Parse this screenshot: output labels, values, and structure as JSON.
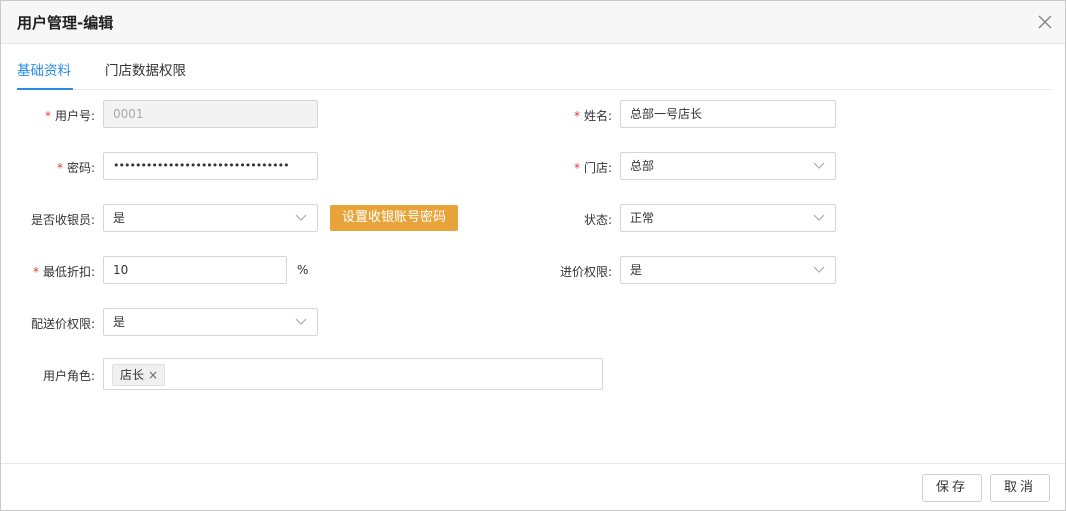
{
  "dialog": {
    "title": "用户管理-编辑"
  },
  "tabs": [
    {
      "label": "基础资料",
      "active": true
    },
    {
      "label": "门店数据权限",
      "active": false
    }
  ],
  "form": {
    "user_no": {
      "label": "用户号:",
      "value": "0001",
      "required": true
    },
    "name": {
      "label": "姓名:",
      "value": "总部一号店长",
      "required": true
    },
    "password": {
      "label": "密码:",
      "value": "••••••••••••••••••••••••••••••••",
      "required": true
    },
    "store": {
      "label": "门店:",
      "value": "总部",
      "required": true
    },
    "is_cashier": {
      "label": "是否收银员:",
      "value": "是"
    },
    "set_cashier_pwd_button": "设置收银账号密码",
    "status": {
      "label": "状态:",
      "value": "正常"
    },
    "min_discount": {
      "label": "最低折扣:",
      "value": "10",
      "unit": "%",
      "required": true
    },
    "purchase_price_perm": {
      "label": "进价权限:",
      "value": "是"
    },
    "delivery_price_perm": {
      "label": "配送价权限:",
      "value": "是"
    },
    "user_role": {
      "label": "用户角色:",
      "tags": [
        "店长"
      ],
      "tag_remove": "×"
    }
  },
  "footer": {
    "save_label": "保存",
    "cancel_label": "取消"
  },
  "colors": {
    "accent": "#2a8be0",
    "required": "#e43b3b",
    "orange_button": "#e8a43b"
  }
}
